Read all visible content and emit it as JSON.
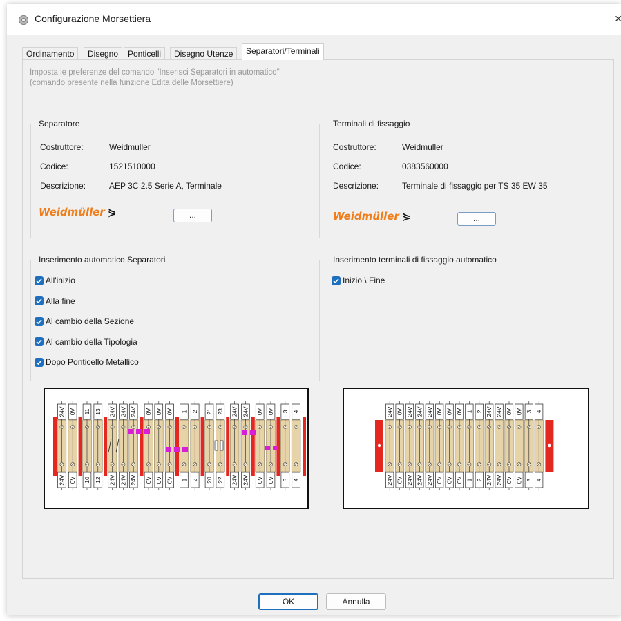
{
  "window": {
    "title": "Configurazione Morsettiera",
    "close_icon": "close-icon"
  },
  "tabs": [
    {
      "label": "Ordinamento",
      "active": false
    },
    {
      "label": "Disegno",
      "active": false
    },
    {
      "label": "Ponticelli",
      "active": false
    },
    {
      "label": "Disegno Utenze",
      "active": false
    },
    {
      "label": "Separatori/Terminali",
      "active": true
    }
  ],
  "hint": {
    "line1": "Imposta le preferenze del comando \"Inserisci Separatori in automatico\"",
    "line2": "(comando presente nella funzione Edita delle Morsettiere)"
  },
  "separatore": {
    "title": "Separatore",
    "costruttore_label": "Costruttore:",
    "costruttore_value": "Weidmuller",
    "codice_label": "Codice:",
    "codice_value": "1521510000",
    "descrizione_label": "Descrizione:",
    "descrizione_value": "AEP 3C 2.5 Serie A, Terminale",
    "brand": "Weidmüller",
    "browse_label": "..."
  },
  "terminali": {
    "title": "Terminali di fissaggio",
    "costruttore_label": "Costruttore:",
    "costruttore_value": "Weidmuller",
    "codice_label": "Codice:",
    "codice_value": "0383560000",
    "descrizione_label": "Descrizione:",
    "descrizione_value": "Terminale di fissaggio per TS 35 EW 35",
    "brand": "Weidmüller",
    "browse_label": "..."
  },
  "inserimento_separatori": {
    "title": "Inserimento automatico Separatori",
    "options": [
      {
        "label": "All'inizio",
        "checked": true
      },
      {
        "label": "Alla fine",
        "checked": true
      },
      {
        "label": "Al cambio della Sezione",
        "checked": true
      },
      {
        "label": "Al cambio della Tipologia",
        "checked": true
      },
      {
        "label": "Dopo Ponticello Metallico",
        "checked": true
      }
    ]
  },
  "inserimento_terminali": {
    "title": "Inserimento terminali di fissaggio automatico",
    "options": [
      {
        "label": "Inizio \\ Fine",
        "checked": true
      }
    ]
  },
  "diagram_left": {
    "top_labels": [
      "24V",
      "0V",
      "11",
      "13",
      "24V",
      "24V",
      "24V",
      "0V",
      "0V",
      "0V",
      "1",
      "2",
      "21",
      "23",
      "24V",
      "24V",
      "0V",
      "0V",
      "3",
      "4"
    ],
    "bottom_labels": [
      "24V",
      "0V",
      "10",
      "12",
      "24V",
      "24V",
      "24V",
      "0V",
      "0V",
      "0V",
      "1",
      "2",
      "20",
      "22",
      "24V",
      "24V",
      "0V",
      "0V",
      "3",
      "4"
    ]
  },
  "diagram_right": {
    "top_labels": [
      "24V",
      "0V",
      "24V",
      "24V",
      "24V",
      "0V",
      "0V",
      "0V",
      "1",
      "2",
      "24V",
      "24V",
      "0V",
      "0V",
      "3",
      "4"
    ],
    "bottom_labels": [
      "24V",
      "0V",
      "24V",
      "24V",
      "24V",
      "0V",
      "0V",
      "0V",
      "1",
      "2",
      "24V",
      "24V",
      "0V",
      "0V",
      "3",
      "4"
    ]
  },
  "colors": {
    "accent": "#1f6fbf",
    "brand": "#ee7d1a",
    "separator": "#e5281f",
    "terminal": "#e6d3a8",
    "bridge": "#d81ed8"
  },
  "footer": {
    "ok_label": "OK",
    "cancel_label": "Annulla"
  }
}
